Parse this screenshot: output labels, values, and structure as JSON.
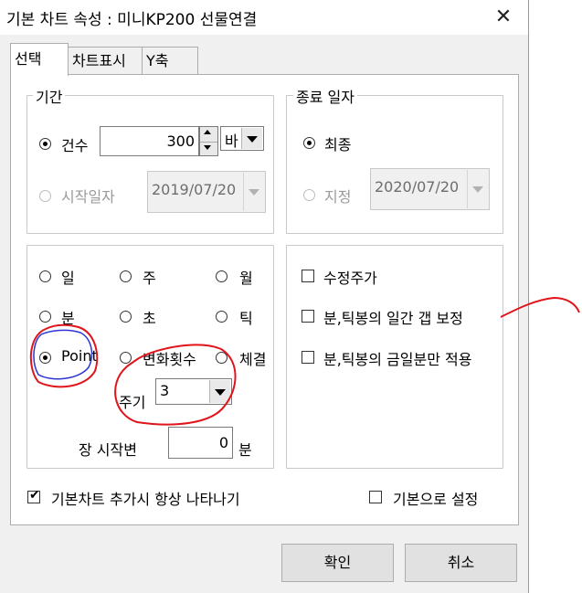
{
  "window": {
    "title": "기본 차트 속성 : 미니KP200 선물연결",
    "close_symbol": "✕"
  },
  "tabs": [
    {
      "label": "선택",
      "active": true
    },
    {
      "label": "차트표시",
      "active": false
    },
    {
      "label": "Y축",
      "active": false
    }
  ],
  "period": {
    "legend": "기간",
    "count": {
      "label": "건수",
      "value": "300",
      "selected": true
    },
    "unit": {
      "value": "바"
    },
    "start_date": {
      "label": "시작일자",
      "value": "2019/07/20",
      "selected": false
    }
  },
  "end_date": {
    "legend": "종료 일자",
    "latest": {
      "label": "최종",
      "selected": true
    },
    "specify": {
      "label": "지정",
      "value": "2020/07/20",
      "selected": false
    }
  },
  "interval": {
    "options": [
      {
        "label": "일",
        "selected": false
      },
      {
        "label": "주",
        "selected": false
      },
      {
        "label": "월",
        "selected": false
      },
      {
        "label": "분",
        "selected": false
      },
      {
        "label": "초",
        "selected": false
      },
      {
        "label": "틱",
        "selected": false
      },
      {
        "label": "Point",
        "selected": true
      },
      {
        "label": "변화횟수",
        "selected": false
      },
      {
        "label": "체결",
        "selected": false
      }
    ],
    "cycle": {
      "label": "주기",
      "value": "3"
    },
    "session_start": {
      "label": "장 시작변",
      "value": "0",
      "unit": "분"
    }
  },
  "adjust": {
    "options": [
      {
        "label": "수정주가",
        "checked": false
      },
      {
        "label": "분,틱봉의 일간 갭 보정",
        "checked": false
      },
      {
        "label": "분,틱봉의 금일분만 적용",
        "checked": false
      }
    ]
  },
  "always_show": {
    "label": "기본차트 추가시 항상 나타나기",
    "checked": true
  },
  "set_default": {
    "label": "기본으로 설정",
    "checked": false
  },
  "buttons": {
    "ok": "확인",
    "cancel": "취소"
  },
  "annotation_color": "#e0141b"
}
